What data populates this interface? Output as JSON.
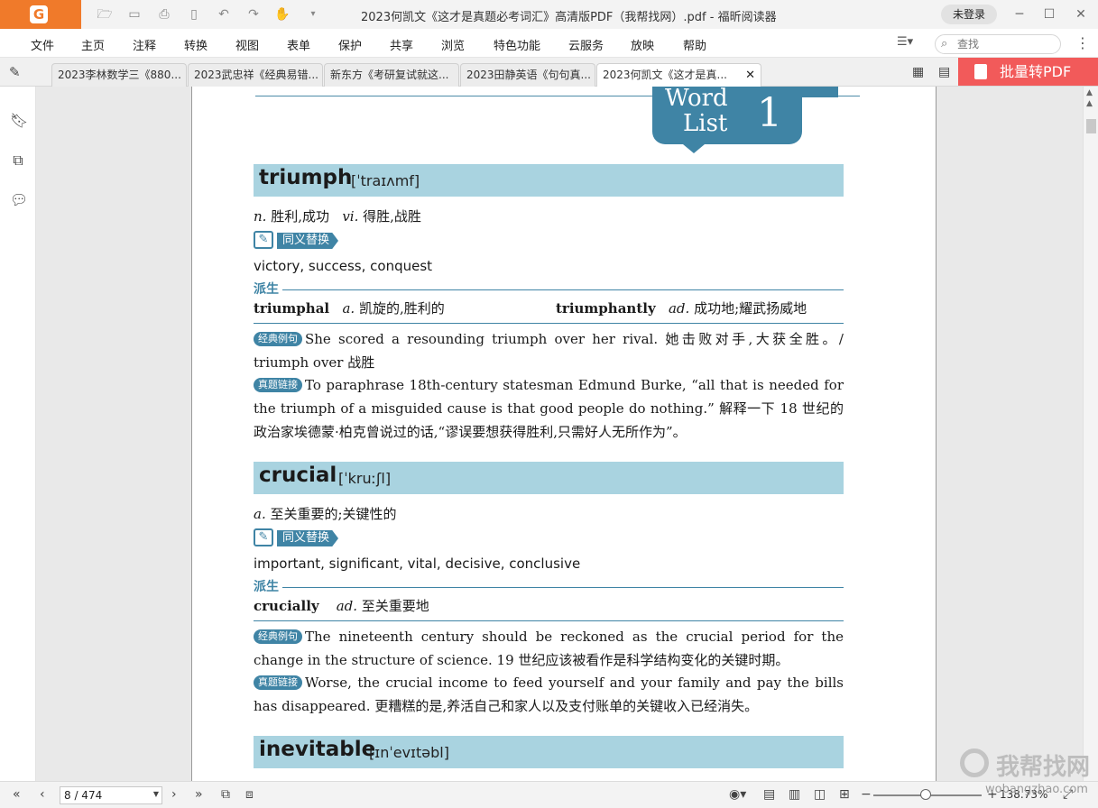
{
  "titlebar": {
    "title": "2023何凯文《这才是真题必考词汇》高清版PDF（我帮找网）.pdf - 福昕阅读器",
    "login_label": "未登录",
    "logo_icon": "foxit-logo-icon"
  },
  "menu": {
    "items": [
      "文件",
      "主页",
      "注释",
      "转换",
      "视图",
      "表单",
      "保护",
      "共享",
      "浏览",
      "特色功能",
      "云服务",
      "放映",
      "帮助"
    ],
    "search_placeholder": "查找"
  },
  "tabs": {
    "items": [
      "2023李林数学三《880...",
      "2023武忠祥《经典易错...",
      "新东方《考研复试就这...",
      "2023田静英语《句句真...",
      "2023何凯文《这才是真..."
    ],
    "close_glyph": "✕",
    "batch_label": "批量转PDF"
  },
  "page": {
    "badge_word": "Word",
    "badge_list": "List",
    "badge_number": "1",
    "synonym_label": "同义替换",
    "derive_label": "派生",
    "example_label": "经典例句",
    "real_label": "真题链接",
    "entries": [
      {
        "word": "triumph",
        "ipa": "[ˈtraɪʌmf]",
        "def_pos1": "n.",
        "def_text1": "胜利,成功",
        "def_pos2": "vi.",
        "def_text2": "得胜,战胜",
        "synonyms": "victory, success, conquest",
        "derive1_word": "triumphal",
        "derive1_pos": "a.",
        "derive1_text": "凯旋的,胜利的",
        "derive2_word": "triumphantly",
        "derive2_pos": "ad.",
        "derive2_text": "成功地;耀武扬威地",
        "example": "She scored a resounding triumph over her rival. 她击败对手,大获全胜。/ triumph over 战胜",
        "real": "To paraphrase 18th-century statesman Edmund Burke, “all that is needed for the triumph of a misguided cause is that good people do nothing.” 解释一下 18 世纪的政治家埃德蒙·柏克曾说过的话,“谬误要想获得胜利,只需好人无所作为”。"
      },
      {
        "word": "crucial",
        "ipa": "[ˈkruːʃl]",
        "def_pos1": "a.",
        "def_text1": "至关重要的;关键性的",
        "synonyms": "important, significant, vital, decisive, conclusive",
        "derive1_word": "crucially",
        "derive1_pos": "ad.",
        "derive1_text": "至关重要地",
        "example": "The nineteenth century should be reckoned as the crucial period for the change in the structure of science. 19 世纪应该被看作是科学结构变化的关键时期。",
        "real": "Worse, the crucial income to feed yourself and your family and pay the bills has disappeared. 更糟糕的是,养活自己和家人以及支付账单的关键收入已经消失。"
      },
      {
        "word": "inevitable",
        "ipa": "[ɪnˈevɪtəbl]"
      }
    ]
  },
  "status": {
    "page_indicator": "8 / 474",
    "zoom": "138.73%"
  },
  "watermark": {
    "cn": "我帮找网",
    "en": "wobangzhao.com"
  }
}
